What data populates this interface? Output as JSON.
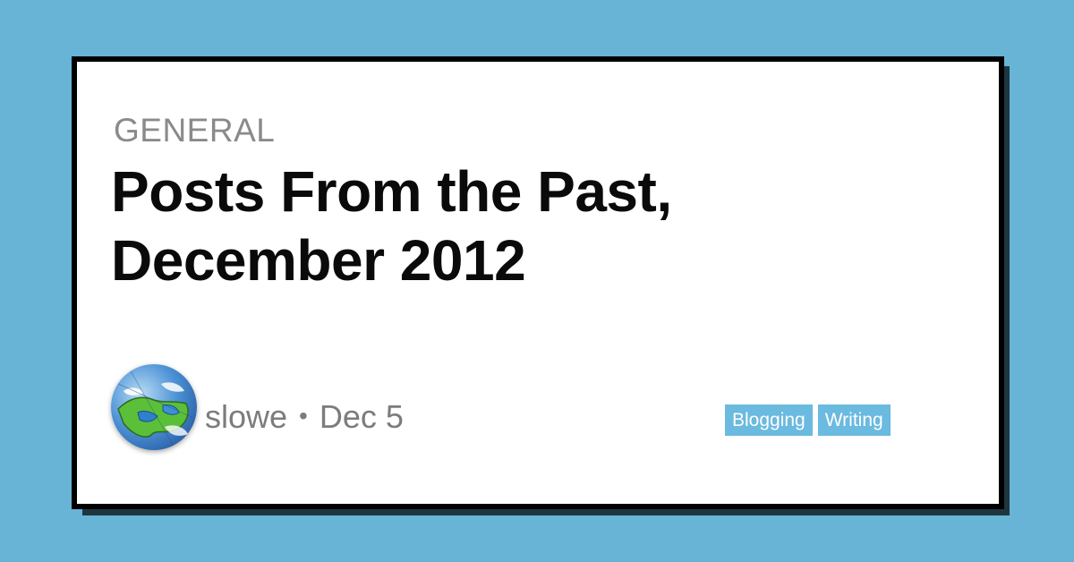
{
  "colors": {
    "background": "#67b4d6",
    "card": "#ffffff",
    "card_border": "#000000",
    "tag_background": "#6bbadf",
    "muted_text": "#8a8a8a"
  },
  "post": {
    "category": "GENERAL",
    "title": "Posts From the Past, December 2012",
    "author": "slowe",
    "separator": "•",
    "date": "Dec 5",
    "avatar_icon": "earth-globe-icon",
    "tags": [
      {
        "label": "Blogging"
      },
      {
        "label": "Writing"
      }
    ]
  }
}
